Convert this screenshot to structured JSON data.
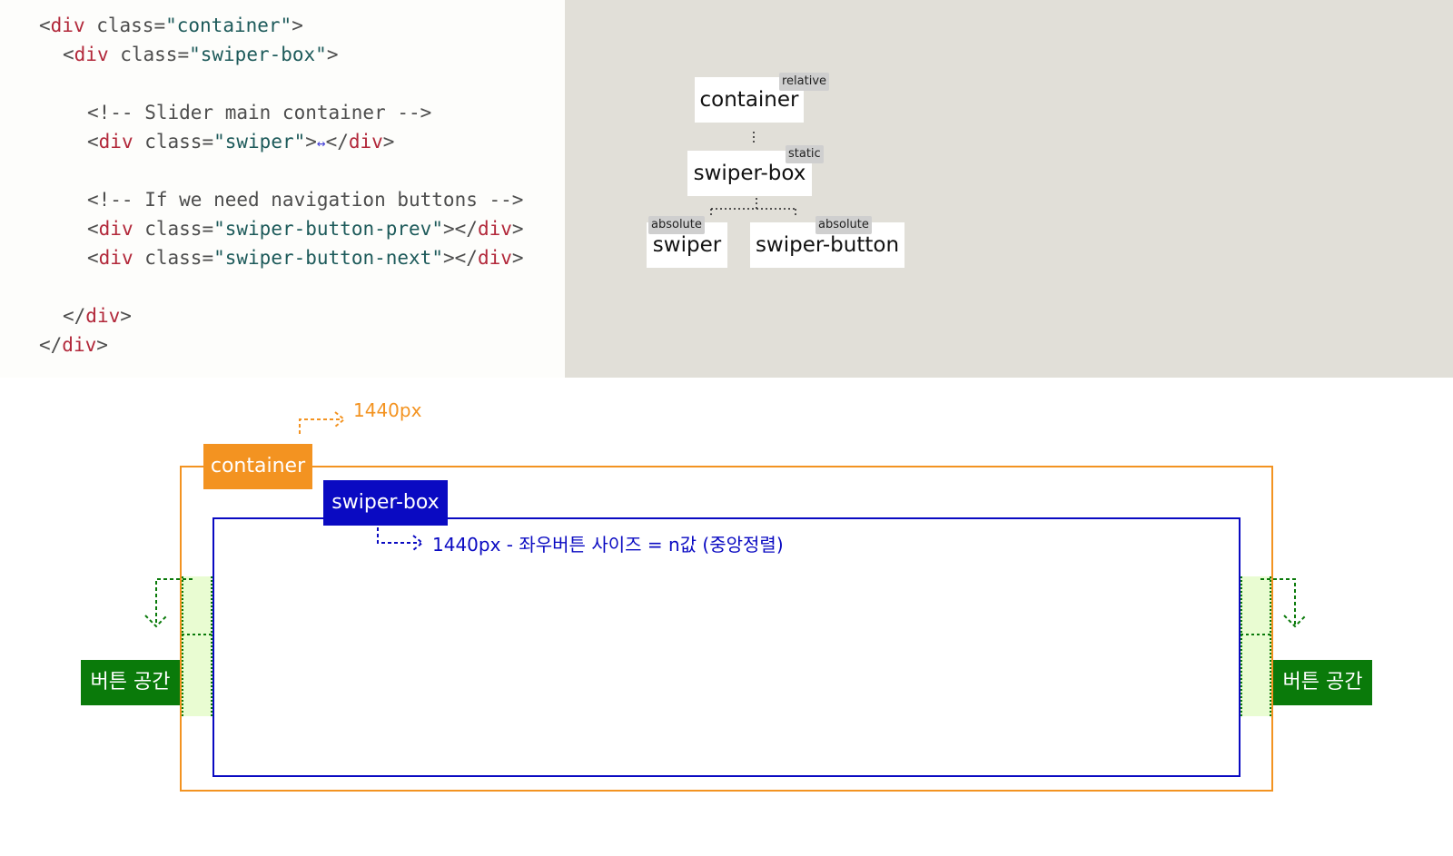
{
  "code": {
    "lines": [
      {
        "indent": "",
        "open": "<",
        "tag": "div",
        "attr": " class=",
        "value": "\"container\"",
        "close": ">"
      },
      {
        "indent": "  ",
        "open": "<",
        "tag": "div",
        "attr": " class=",
        "value": "\"swiper-box\"",
        "close": ">"
      },
      {
        "indent": "    ",
        "comment": "<!-- Slider main container -->"
      },
      {
        "indent": "    ",
        "open": "<",
        "tag": "div",
        "attr": " class=",
        "value": "\"swiper\"",
        "close": ">",
        "inner": "↔",
        "end_open": "</",
        "end_tag": "div",
        "end_close": ">"
      },
      {
        "indent": "    ",
        "comment": "<!-- If we need navigation buttons -->"
      },
      {
        "indent": "    ",
        "open": "<",
        "tag": "div",
        "attr": " class=",
        "value": "\"swiper-button-prev\"",
        "close": ">",
        "end_open": "</",
        "end_tag": "div",
        "end_close": ">"
      },
      {
        "indent": "    ",
        "open": "<",
        "tag": "div",
        "attr": " class=",
        "value": "\"swiper-button-next\"",
        "close": ">",
        "end_open": "</",
        "end_tag": "div",
        "end_close": ">"
      },
      {
        "indent": "  ",
        "end_open": "</",
        "end_tag": "div",
        "end_close": ">"
      },
      {
        "indent": "",
        "end_open": "</",
        "end_tag": "div",
        "end_close": ">"
      }
    ]
  },
  "tree": {
    "container": {
      "label": "container",
      "badge": "relative"
    },
    "swiper_box": {
      "label": "swiper-box",
      "badge": "static"
    },
    "swiper": {
      "label": "swiper",
      "badge": "absolute"
    },
    "swiper_button": {
      "label": "swiper-button",
      "badge": "absolute"
    }
  },
  "diagram": {
    "container_label": "container",
    "container_width_note": "1440px",
    "swiper_box_label": "swiper-box",
    "swiper_box_note": "1440px - 좌우버튼 사이즈 = n값 (중앙정렬)",
    "left_button_label": "버튼 공간",
    "right_button_label": "버튼 공간",
    "colors": {
      "container": "#f39321",
      "swiper_box": "#0a0ac2",
      "button": "#0a7a0a",
      "button_area": "#e9fcd2",
      "tree_bg": "#e1dfd8"
    }
  }
}
